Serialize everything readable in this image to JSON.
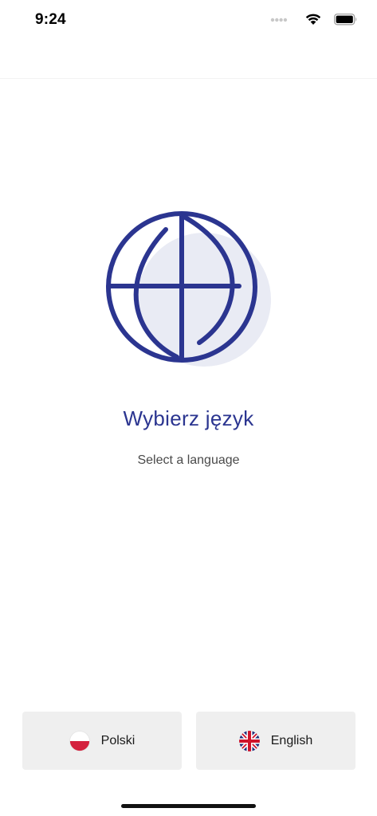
{
  "status_bar": {
    "time": "9:24",
    "icons": [
      "signal-icon",
      "wifi-icon",
      "battery-icon"
    ]
  },
  "illustration": {
    "icon": "globe-icon",
    "stroke_color": "#2b3590",
    "bg_color": "#e9ebf4"
  },
  "main": {
    "title": "Wybierz język",
    "subtitle": "Select a language"
  },
  "languages": [
    {
      "label": "Polski",
      "flag": "poland-flag-icon"
    },
    {
      "label": "English",
      "flag": "uk-flag-icon"
    }
  ],
  "colors": {
    "accent": "#2b3590",
    "button_bg": "#efefef",
    "text": "#1a1a1a"
  }
}
